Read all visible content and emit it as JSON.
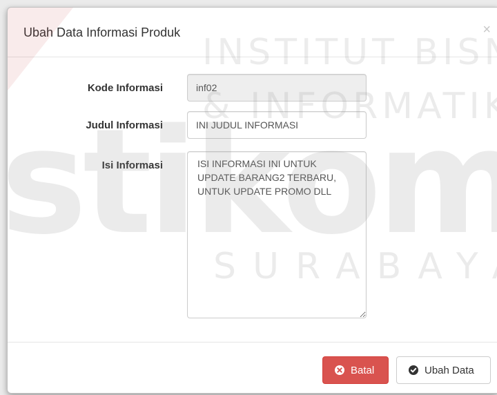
{
  "modal": {
    "title": "Ubah Data Informasi Produk",
    "close_symbol": "×"
  },
  "form": {
    "fields": [
      {
        "label": "Kode Informasi",
        "value": "inf02",
        "readonly": true
      },
      {
        "label": "Judul Informasi",
        "value": "INI JUDUL INFORMASI"
      },
      {
        "label": "Isi Informasi",
        "value": "ISI INFORMASI INI UNTUK UPDATE BARANG2 TERBARU, UNTUK UPDATE PROMO DLL"
      }
    ]
  },
  "footer": {
    "cancel_label": "Batal",
    "cancel_icon": "times-circle-icon",
    "submit_label": "Ubah Data",
    "submit_icon": "check-circle-icon"
  },
  "colors": {
    "danger": "#d9534f",
    "default_border": "#cccccc",
    "readonly_bg": "#eeeeee"
  },
  "watermark": {
    "line1": "INSTITUT BISNIS",
    "line2": "& INFORMATIKA",
    "logo_word": "stikom",
    "line3": "SURABAYA"
  }
}
